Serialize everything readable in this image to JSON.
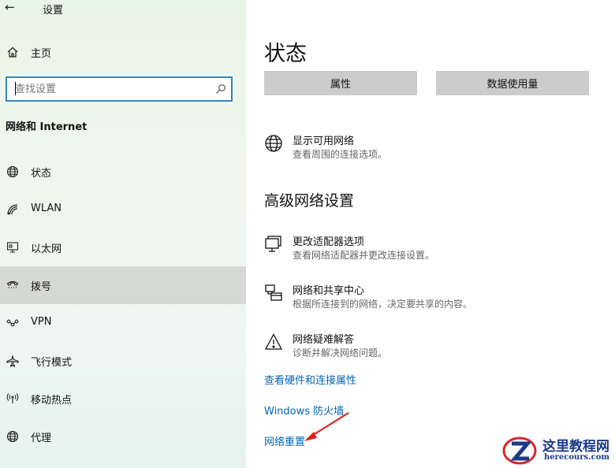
{
  "window": {
    "back_label": "←",
    "title": "设置"
  },
  "sidebar": {
    "home": {
      "label": "主页",
      "icon": "home-icon"
    },
    "search": {
      "placeholder": "查找设置",
      "value": ""
    },
    "section_title": "网络和 Internet",
    "items": [
      {
        "label": "状态",
        "icon": "globe-icon",
        "active": false
      },
      {
        "label": "WLAN",
        "icon": "wifi-icon",
        "active": false
      },
      {
        "label": "以太网",
        "icon": "ethernet-icon",
        "active": false
      },
      {
        "label": "拨号",
        "icon": "dialup-icon",
        "active": true
      },
      {
        "label": "VPN",
        "icon": "vpn-icon",
        "active": false
      },
      {
        "label": "飞行模式",
        "icon": "airplane-icon",
        "active": false
      },
      {
        "label": "移动热点",
        "icon": "hotspot-icon",
        "active": false
      },
      {
        "label": "代理",
        "icon": "globe-icon",
        "active": false
      }
    ]
  },
  "main": {
    "title": "状态",
    "buttons": {
      "properties": "属性",
      "data_usage": "数据使用量"
    },
    "show_networks": {
      "title": "显示可用网络",
      "desc": "查看周围的连接选项。",
      "icon": "globe-icon"
    },
    "advanced_heading": "高级网络设置",
    "options": [
      {
        "title": "更改适配器选项",
        "desc": "查看网络适配器并更改连接设置。",
        "icon": "monitor-icon"
      },
      {
        "title": "网络和共享中心",
        "desc": "根据所连接到的网络，决定要共享的内容。",
        "icon": "sharing-icon"
      },
      {
        "title": "网络疑难解答",
        "desc": "诊断并解决网络问题。",
        "icon": "warning-icon"
      }
    ],
    "links": {
      "hardware": "查看硬件和连接属性",
      "firewall": "Windows 防火墙",
      "reset": "网络重置"
    }
  },
  "watermark": {
    "text": "这里教程网",
    "url": "herecours.com"
  },
  "colors": {
    "accent": "#0066b4",
    "search_border": "#3385c7",
    "active_item": "#d6d8d4",
    "button": "#cccccc",
    "arrow": "#e02020"
  }
}
